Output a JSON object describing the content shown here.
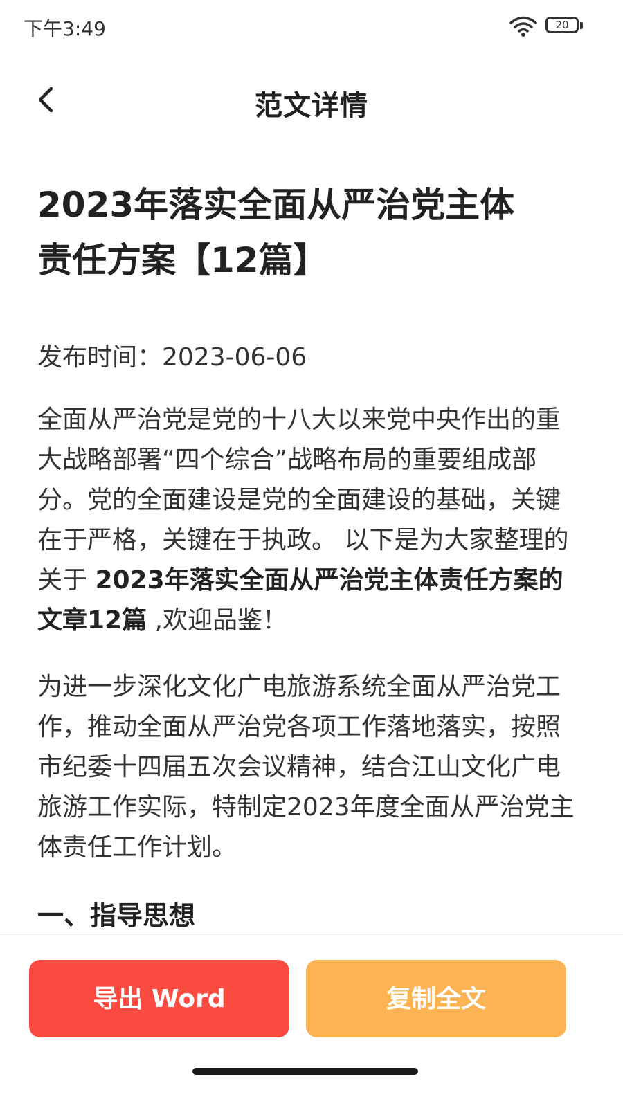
{
  "status_bar": {
    "time": "下午3:49",
    "battery": "20",
    "icons": [
      "wifi-icon",
      "battery-icon"
    ]
  },
  "nav": {
    "back_icon": "chevron-left-icon",
    "title": "范文详情"
  },
  "article": {
    "title_line1": "2023年落实全面从严治党主体",
    "title_line2": "责任方案【12篇】",
    "publish_time": "发布时间：2023-06-06",
    "intro_text": "全面从严治党是党的十八大以来党中央作出的重大战略部署“四个综合”战略布局的重要组成部分。党的全面建设是党的全面建设的基础，关键在于严格，关键在于执政。 以下是为大家整理的关于 ",
    "intro_bold": "2023年落实全面从严治党主体责任方案的文章12篇",
    "intro_tail": " ,欢迎品鉴！",
    "paragraph2": "为进一步深化文化广电旅游系统全面从严治党工作，推动全面从严治党各项工作落地落实，按照市纪委十四届五次会议精神，结合江山文化广电旅游工作实际，特制定2023年度全面从严治党主体责任工作计划。",
    "section1": "一、指导思想"
  },
  "actions": {
    "export_label": "导出 Word",
    "copy_label": "复制全文"
  },
  "colors": {
    "export_button": "#fb4b40",
    "copy_button": "#fcb354",
    "text": "#222222"
  }
}
